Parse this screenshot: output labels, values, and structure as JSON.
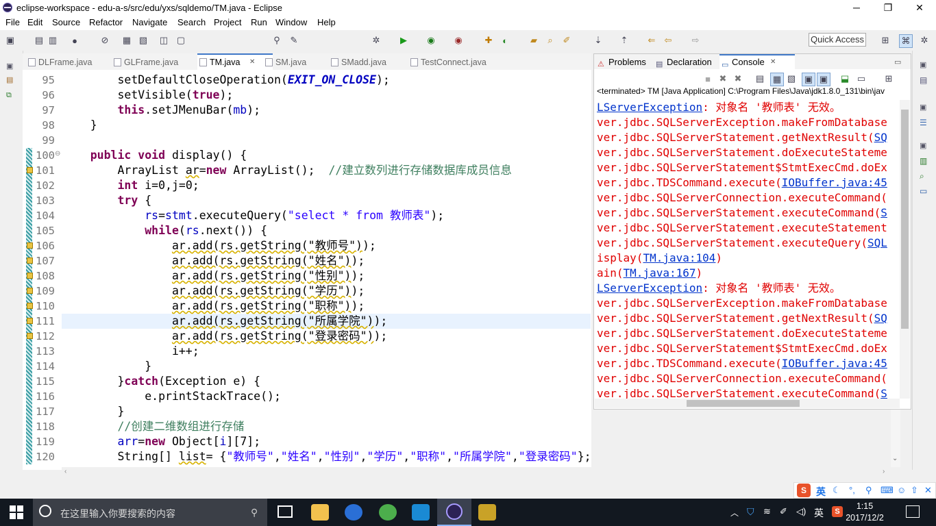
{
  "window": {
    "title": "eclipse-workspace - edu-a-s/src/edu/yxs/sqldemo/TM.java - Eclipse",
    "controls": [
      "─",
      "❐",
      "✕"
    ]
  },
  "menu": [
    "File",
    "Edit",
    "Source",
    "Refactor",
    "Navigate",
    "Search",
    "Project",
    "Run",
    "Window",
    "Help"
  ],
  "toolbar": {
    "quick_access": "Quick Access",
    "icons": [
      "new-icon",
      "save-icon",
      "print-icon",
      "debug-icon",
      "run-icon",
      "search-icon",
      "back-icon",
      "forward-icon",
      "perspective-icon"
    ]
  },
  "editor": {
    "tabs": [
      {
        "label": "DLFrame.java",
        "active": false
      },
      {
        "label": "GLFrame.java",
        "active": false
      },
      {
        "label": "TM.java",
        "active": true,
        "close": "✕"
      },
      {
        "label": "SM.java",
        "active": false
      },
      {
        "label": "SMadd.java",
        "active": false
      },
      {
        "label": "TestConnect.java",
        "active": false
      }
    ],
    "line_numbers": [
      "95",
      "96",
      "97",
      "98",
      "99",
      "100",
      "101",
      "102",
      "103",
      "104",
      "105",
      "106",
      "107",
      "108",
      "109",
      "110",
      "111",
      "112",
      "113",
      "114",
      "115",
      "116",
      "117",
      "118",
      "119",
      "120"
    ],
    "fold_marker": "⊖"
  },
  "console": {
    "tabs": [
      {
        "label": "Problems",
        "active": false
      },
      {
        "label": "Declaration",
        "active": false
      },
      {
        "label": "Console",
        "active": true,
        "close": "✕"
      }
    ],
    "status": "<terminated> TM [Java Application] C:\\Program Files\\Java\\jdk1.8.0_131\\bin\\jav",
    "lines": [
      {
        "pre": "",
        "link": "LServerException",
        "post": ": 对象名 '教师表' 无效。"
      },
      {
        "pre": "ver.jdbc.SQLServerException.makeFromDatabase",
        "link": "",
        "post": ""
      },
      {
        "pre": "ver.jdbc.SQLServerStatement.getNextResult(",
        "link": "SQ",
        "post": ""
      },
      {
        "pre": "ver.jdbc.SQLServerStatement.doExecuteStateme",
        "link": "",
        "post": ""
      },
      {
        "pre": "ver.jdbc.SQLServerStatement$StmtExecCmd.doEx",
        "link": "",
        "post": ""
      },
      {
        "pre": "ver.jdbc.TDSCommand.execute(",
        "link": "IOBuffer.java:45",
        "post": ""
      },
      {
        "pre": "ver.jdbc.SQLServerConnection.executeCommand(",
        "link": "",
        "post": ""
      },
      {
        "pre": "ver.jdbc.SQLServerStatement.executeCommand(",
        "link": "S",
        "post": ""
      },
      {
        "pre": "ver.jdbc.SQLServerStatement.executeStatement",
        "link": "",
        "post": ""
      },
      {
        "pre": "ver.jdbc.SQLServerStatement.executeQuery(",
        "link": "SQL",
        "post": ""
      },
      {
        "pre": "isplay(",
        "link": "TM.java:104",
        "post": ")"
      },
      {
        "pre": "ain(",
        "link": "TM.java:167",
        "post": ")"
      },
      {
        "pre": "",
        "link": "LServerException",
        "post": ": 对象名 '教师表' 无效。"
      },
      {
        "pre": "ver.jdbc.SQLServerException.makeFromDatabase",
        "link": "",
        "post": ""
      },
      {
        "pre": "ver.jdbc.SQLServerStatement.getNextResult(",
        "link": "SQ",
        "post": ""
      },
      {
        "pre": "ver.jdbc.SQLServerStatement.doExecuteStateme",
        "link": "",
        "post": ""
      },
      {
        "pre": "ver.jdbc.SQLServerStatement$StmtExecCmd.doEx",
        "link": "",
        "post": ""
      },
      {
        "pre": "ver.jdbc.TDSCommand.execute(",
        "link": "IOBuffer.java:45",
        "post": ""
      },
      {
        "pre": "ver.jdbc.SQLServerConnection.executeCommand(",
        "link": "",
        "post": ""
      },
      {
        "pre": "ver.jdbc.SQLServerStatement.executeCommand(",
        "link": "S",
        "post": ""
      }
    ]
  },
  "ime": {
    "mode": "英",
    "logo": "S"
  },
  "taskbar": {
    "search_placeholder": "在这里输入你要搜索的内容",
    "tray_lang": "英",
    "time": "1:15",
    "date": "2017/12/2"
  },
  "colors": {
    "keyword": "#7f0055",
    "string": "#2a00ff",
    "comment": "#3f7f5f",
    "field": "#0000c0",
    "error": "#e00000",
    "link": "#0033cc",
    "taskbar": "#121820"
  }
}
